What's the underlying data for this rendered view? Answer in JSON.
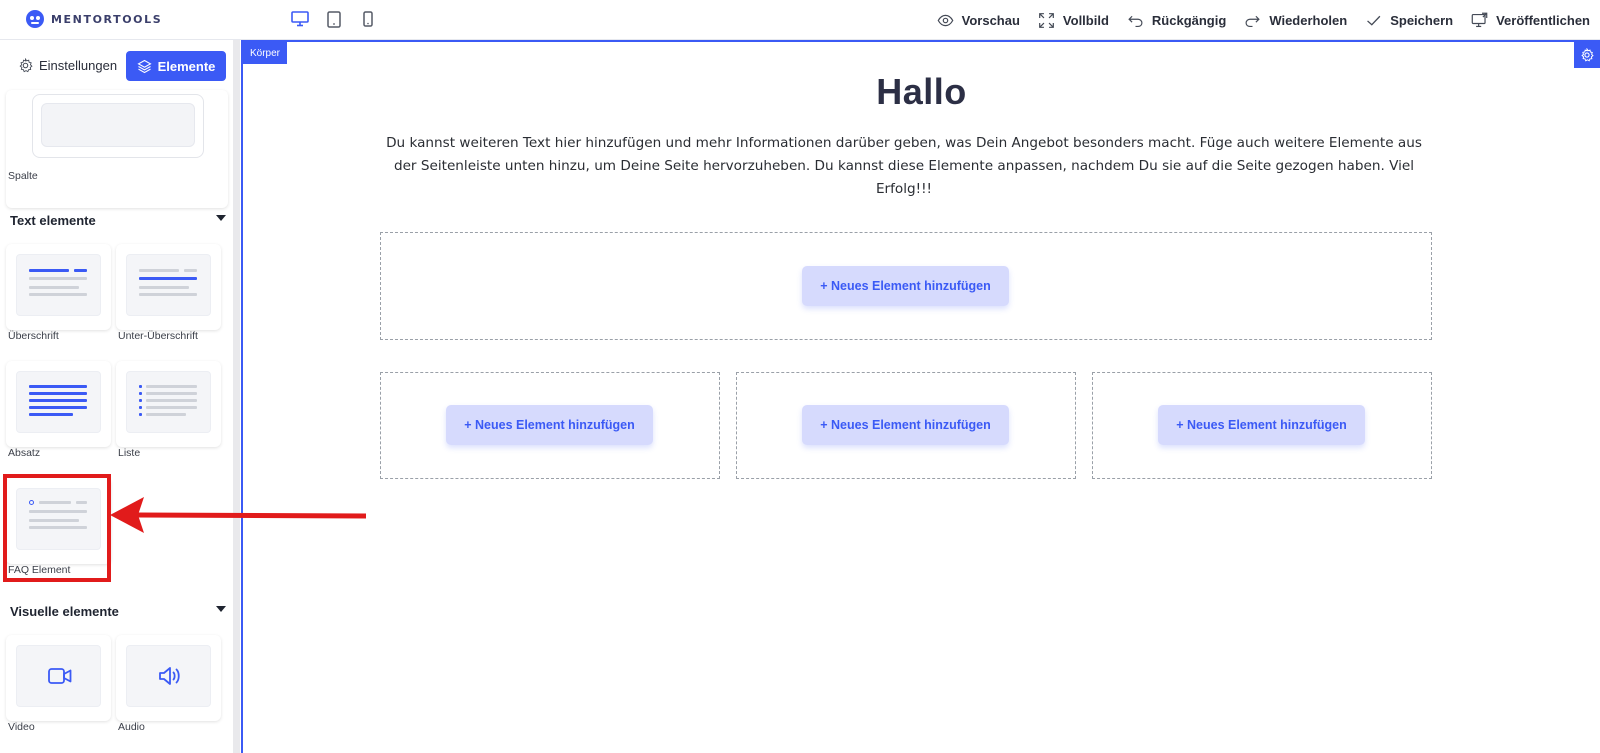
{
  "app": {
    "logo_text": "MENTORTOOLS"
  },
  "toolbar": {
    "devices": [
      "desktop",
      "tablet",
      "mobile"
    ],
    "actions": [
      {
        "id": "preview",
        "label": "Vorschau",
        "icon": "eye-icon"
      },
      {
        "id": "fullscreen",
        "label": "Vollbild",
        "icon": "expand-icon"
      },
      {
        "id": "undo",
        "label": "Rückgängig",
        "icon": "undo-icon"
      },
      {
        "id": "redo",
        "label": "Wiederholen",
        "icon": "redo-icon"
      },
      {
        "id": "save",
        "label": "Speichern",
        "icon": "check-icon"
      },
      {
        "id": "publish",
        "label": "Veröffentlichen",
        "icon": "publish-icon"
      }
    ]
  },
  "sidebar": {
    "tab_settings": "Einstellungen",
    "tab_elements": "Elemente",
    "spalte_label": "Spalte",
    "sections": [
      {
        "title": "Text elemente",
        "items": [
          {
            "label": "Überschrift"
          },
          {
            "label": "Unter-Überschrift"
          },
          {
            "label": "Absatz"
          },
          {
            "label": "Liste"
          },
          {
            "label": "FAQ Element"
          }
        ]
      },
      {
        "title": "Visuelle elemente",
        "items": [
          {
            "label": "Video"
          },
          {
            "label": "Audio"
          }
        ]
      }
    ]
  },
  "canvas": {
    "body_label": "Körper",
    "title": "Hallo",
    "text": "Du kannst weiteren Text hier hinzufügen und mehr Informationen darüber geben, was Dein Angebot besonders macht. Füge auch weitere Elemente aus der Seitenleiste unten hinzu, um Deine Seite hervorzuheben. Du kannst diese Elemente anpassen, nachdem Du sie auf die Seite gezogen haben. Viel Erfolg!!!",
    "add_label": "+ Neues Element hinzufügen"
  },
  "colors": {
    "accent": "#3b5af5",
    "annotation": "#e11b1b"
  }
}
